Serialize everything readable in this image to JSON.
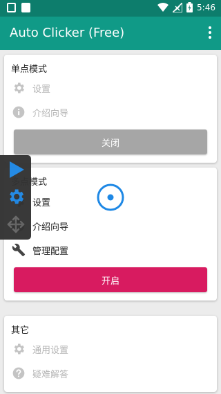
{
  "status_bar": {
    "time": "5:46"
  },
  "app_bar": {
    "title": "Auto Clicker (Free)",
    "menu_icon": "more-vert-icon"
  },
  "single_mode": {
    "title": "单点模式",
    "items": [
      {
        "label": "设置",
        "icon": "gear-icon",
        "enabled": false
      },
      {
        "label": "介绍向导",
        "icon": "info-icon",
        "enabled": false
      }
    ],
    "button_label": "关闭"
  },
  "multi_mode": {
    "title": "多点模式",
    "items": [
      {
        "label": "设置",
        "icon": "gear-icon",
        "enabled": true
      },
      {
        "label": "介绍向导",
        "icon": "info-icon",
        "enabled": true
      },
      {
        "label": "管理配置",
        "icon": "wrench-icon",
        "enabled": true
      }
    ],
    "button_label": "开启"
  },
  "other": {
    "title": "其它",
    "items": [
      {
        "label": "通用设置",
        "icon": "gear-icon",
        "enabled": false
      },
      {
        "label": "疑难解答",
        "icon": "help-icon",
        "enabled": false
      }
    ]
  },
  "floating_toolbar": {
    "icons": [
      "play-icon",
      "gear-icon",
      "move-icon"
    ]
  },
  "colors": {
    "primary": "#109a87",
    "primary_dark": "#0d7d6c",
    "accent": "#d81b60",
    "disabled_button": "#a6a6a6",
    "target": "#1e88e5"
  }
}
